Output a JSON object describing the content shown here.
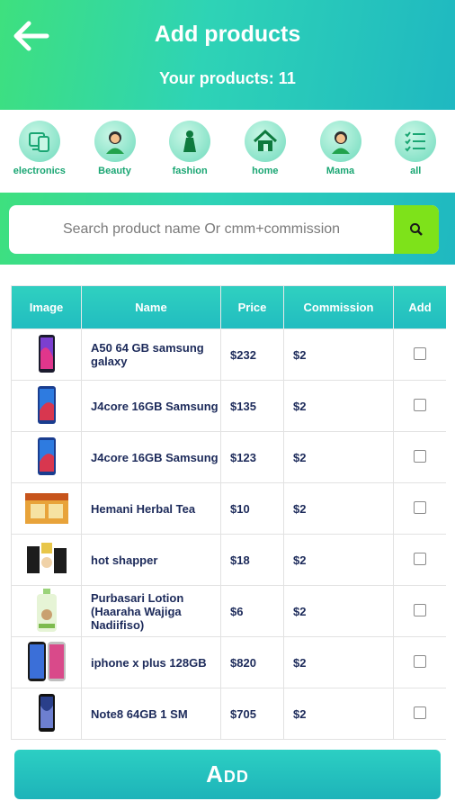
{
  "header": {
    "title": "Add products",
    "subtitle": "Your products: 11",
    "back_icon": "arrow-left-icon"
  },
  "categories": [
    {
      "label": "electronics",
      "icon": "devices-icon"
    },
    {
      "label": "Beauty",
      "icon": "woman-icon"
    },
    {
      "label": "fashion",
      "icon": "dress-icon"
    },
    {
      "label": "home",
      "icon": "house-icon"
    },
    {
      "label": "Mama",
      "icon": "woman-icon"
    },
    {
      "label": "all",
      "icon": "checklist-icon"
    }
  ],
  "search": {
    "placeholder": "Search product name Or cmm+commission",
    "button_icon": "search-icon"
  },
  "table": {
    "headers": [
      "Image",
      "Name",
      "Price",
      "Commission",
      "Add"
    ],
    "rows": [
      {
        "name": "A50 64 GB samsung galaxy",
        "price": "$232",
        "commission": "$2",
        "image": "phone-icon",
        "checked": false
      },
      {
        "name": "J4core 16GB Samsung",
        "price": "$135",
        "commission": "$2",
        "image": "phone-icon",
        "checked": false
      },
      {
        "name": "J4core 16GB Samsung",
        "price": "$123",
        "commission": "$2",
        "image": "phone-icon",
        "checked": false
      },
      {
        "name": "Hemani Herbal Tea",
        "price": "$10",
        "commission": "$2",
        "image": "tea-box-icon",
        "checked": false
      },
      {
        "name": "hot shapper",
        "price": "$18",
        "commission": "$2",
        "image": "shaper-icon",
        "checked": false
      },
      {
        "name": "Purbasari Lotion (Haaraha Wajiga Nadiifiso)",
        "price": "$6",
        "commission": "$2",
        "image": "lotion-icon",
        "checked": false
      },
      {
        "name": "iphone x plus 128GB",
        "price": "$820",
        "commission": "$2",
        "image": "phone-icon",
        "checked": false
      },
      {
        "name": "Note8 64GB 1 SM",
        "price": "$705",
        "commission": "$2",
        "image": "phone-icon",
        "checked": false
      }
    ]
  },
  "footer": {
    "add_label": "Add"
  },
  "colors": {
    "accent": "#22c1c3",
    "green": "#3ee07e",
    "search_button": "#7ee21a"
  }
}
